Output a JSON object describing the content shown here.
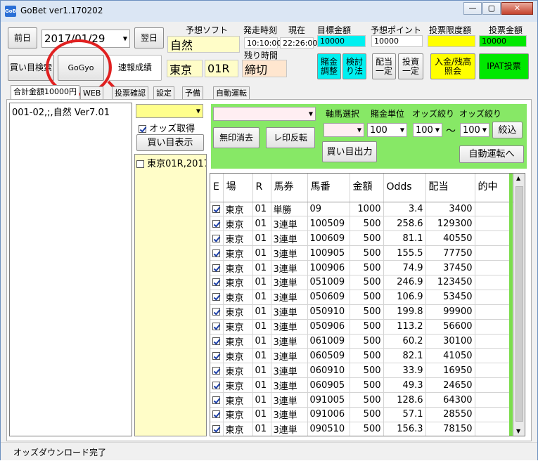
{
  "window": {
    "title": "GoBet ver1.170202",
    "icon_text": "GoB",
    "controls": [
      "—",
      "▢",
      "✕"
    ]
  },
  "toolbar": {
    "prev_day": "前日",
    "date_value": "2017/01/29",
    "next_day": "翌日",
    "search_buy": "買い目検索",
    "gogyo": "GoGyo",
    "results": "速報成績"
  },
  "header": {
    "soft_label": "予想ソフト",
    "soft_value": "自然",
    "start_time_label": "発走時刻",
    "start_time_value": "10:10:00",
    "now_label": "現在",
    "now_value": "22:26:00",
    "remain_label": "残り時間",
    "remain_value": "締切",
    "venue": "東京",
    "race": "01R",
    "target_label": "目標金額",
    "target_value": "10000",
    "points_label": "予想ポイント",
    "points_value": "10000",
    "limit_label": "投票限度額",
    "limit_value": "",
    "vote_label": "投票金額",
    "vote_value": "10000"
  },
  "actions": {
    "bet_adjust": "賭金調整",
    "verify": "検討り法",
    "payout_fixed": "配当一定",
    "invest_fixed": "投資一定",
    "deposit": "入金/残高照会",
    "ipat": "IPAT投票"
  },
  "colors": {
    "cyan": "#00f0f0",
    "yellow": "#ffff00",
    "green": "#00e800",
    "light_yellow": "#fffdc8",
    "peach": "#ffe6cf",
    "panel_green": "#87e866"
  },
  "tabs": [
    "合計金額10000円",
    "WEB",
    "投票確認",
    "設定",
    "予備",
    "自動運転"
  ],
  "left_panel": {
    "list_items": [
      "001-02,;,自然 Ver7.01"
    ]
  },
  "middle_panel": {
    "odds_checkbox_label": "オッズ取得",
    "show_buy_button": "買い目表示",
    "race_item": "東京01R,2017"
  },
  "filters": {
    "unmark": "無印消去",
    "reverse": "レ印反転",
    "axis_label": "軸馬選択",
    "bet_unit_label": "賭金単位",
    "odds_filter_label": "オッズ絞り",
    "odds_filter_label2": "オッズ絞り",
    "bet_unit_value": "100",
    "odds_min_value": "100",
    "tilde": "～",
    "odds_max_value": "100",
    "narrow": "絞込",
    "output": "買い目出力",
    "auto": "自動運転へ"
  },
  "grid": {
    "headers": [
      "E",
      "場",
      "R",
      "馬券",
      "馬番",
      "金額",
      "Odds",
      "配当",
      "的中"
    ],
    "rows": [
      [
        "東京",
        "01",
        "単勝",
        "09",
        "1000",
        "3.4",
        "3400"
      ],
      [
        "東京",
        "01",
        "3連単",
        "100509",
        "500",
        "258.6",
        "129300"
      ],
      [
        "東京",
        "01",
        "3連単",
        "100609",
        "500",
        "81.1",
        "40550"
      ],
      [
        "東京",
        "01",
        "3連単",
        "100905",
        "500",
        "155.5",
        "77750"
      ],
      [
        "東京",
        "01",
        "3連単",
        "100906",
        "500",
        "74.9",
        "37450"
      ],
      [
        "東京",
        "01",
        "3連単",
        "051009",
        "500",
        "246.9",
        "123450"
      ],
      [
        "東京",
        "01",
        "3連単",
        "050609",
        "500",
        "106.9",
        "53450"
      ],
      [
        "東京",
        "01",
        "3連単",
        "050910",
        "500",
        "199.8",
        "99900"
      ],
      [
        "東京",
        "01",
        "3連単",
        "050906",
        "500",
        "113.2",
        "56600"
      ],
      [
        "東京",
        "01",
        "3連単",
        "061009",
        "500",
        "60.2",
        "30100"
      ],
      [
        "東京",
        "01",
        "3連単",
        "060509",
        "500",
        "82.1",
        "41050"
      ],
      [
        "東京",
        "01",
        "3連単",
        "060910",
        "500",
        "33.9",
        "16950"
      ],
      [
        "東京",
        "01",
        "3連単",
        "060905",
        "500",
        "49.3",
        "24650"
      ],
      [
        "東京",
        "01",
        "3連単",
        "091005",
        "500",
        "128.6",
        "64300"
      ],
      [
        "東京",
        "01",
        "3連単",
        "091006",
        "500",
        "57.1",
        "28550"
      ],
      [
        "東京",
        "01",
        "3連単",
        "090510",
        "500",
        "156.3",
        "78150"
      ]
    ]
  },
  "status": {
    "text": "オッズダウンロード完了"
  }
}
